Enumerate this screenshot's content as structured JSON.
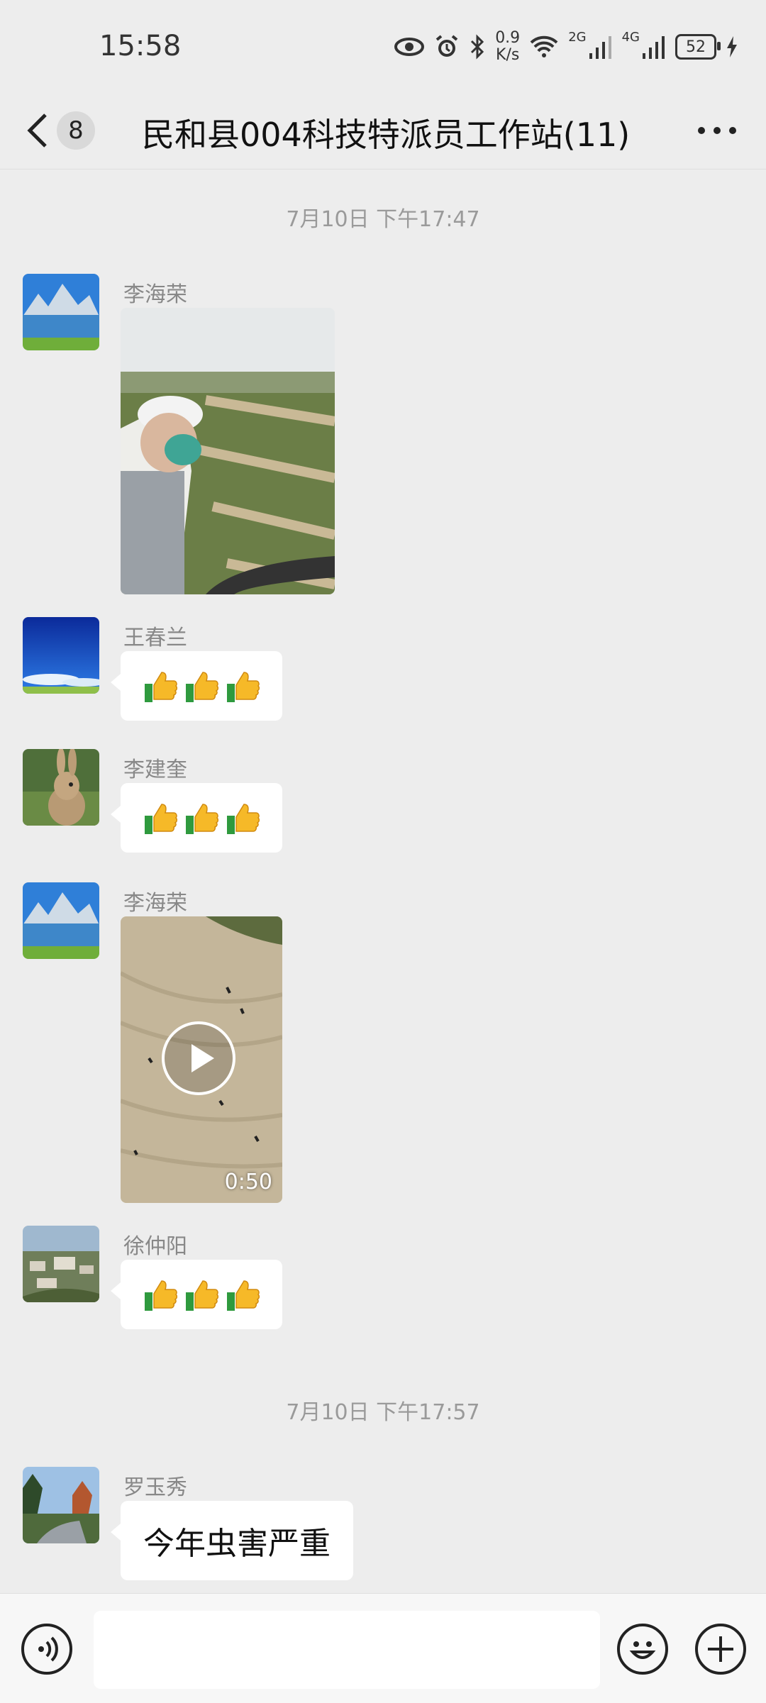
{
  "status_bar": {
    "time": "15:58",
    "speed_value": "0.9",
    "speed_unit": "K/s",
    "net1": "2G",
    "net2": "4G",
    "battery": "52"
  },
  "header": {
    "unread_count": "8",
    "title": "民和县004科技特派员工作站(11)"
  },
  "timestamps": [
    "7月10日 下午17:47",
    "7月10日 下午17:57"
  ],
  "messages": [
    {
      "sender": "李海荣",
      "type": "image"
    },
    {
      "sender": "王春兰",
      "type": "emoji",
      "content": "👍👍👍"
    },
    {
      "sender": "李建奎",
      "type": "emoji",
      "content": "👍👍👍"
    },
    {
      "sender": "李海荣",
      "type": "video",
      "duration": "0:50"
    },
    {
      "sender": "徐仲阳",
      "type": "emoji",
      "content": "👍👍👍"
    },
    {
      "sender": "罗玉秀",
      "type": "text",
      "content": "今年虫害严重"
    }
  ],
  "icons": {
    "back": "chevron-left-icon",
    "more": "more-icon",
    "voice": "voice-icon",
    "emoji": "emoji-icon",
    "add": "plus-icon"
  },
  "colors": {
    "background": "#ededed",
    "bubble": "#ffffff",
    "timestamp": "#9a9a9a"
  }
}
